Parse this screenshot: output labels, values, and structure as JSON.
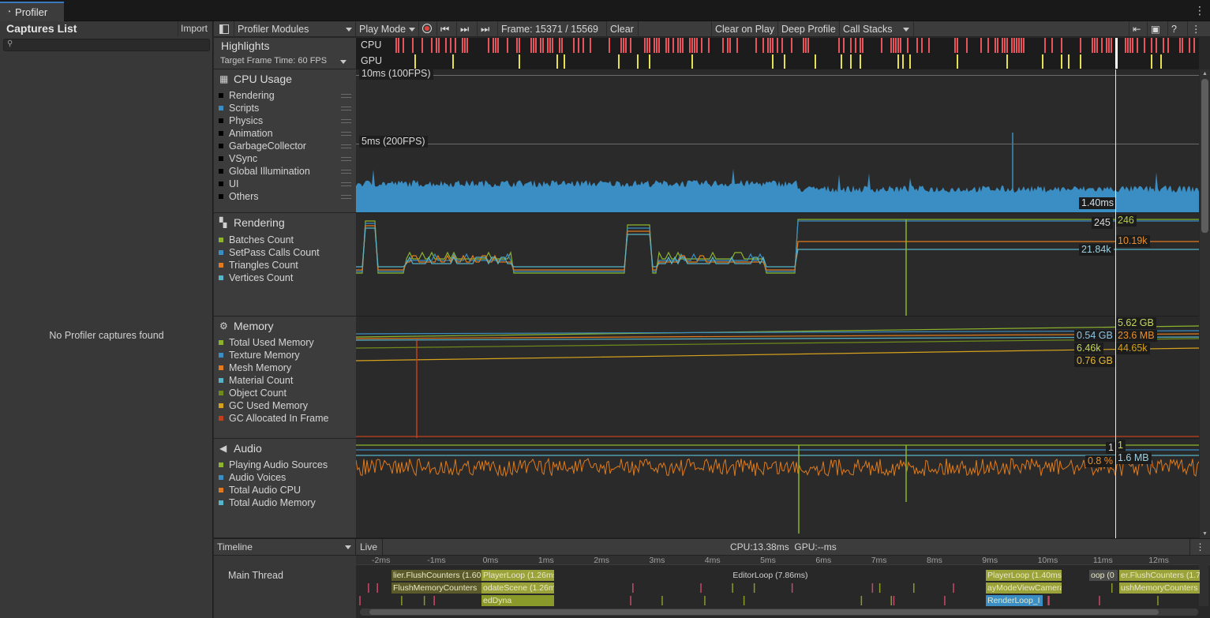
{
  "window": {
    "tab_title": "Profiler"
  },
  "captures": {
    "title": "Captures List",
    "import_label": "Import",
    "search_placeholder": "",
    "empty_message": "No Profiler captures found"
  },
  "toolbar": {
    "modules_label": "Profiler Modules",
    "play_mode_label": "Play Mode",
    "frame_label": "Frame: 15371 / 15569",
    "clear_label": "Clear",
    "clear_on_play_label": "Clear on Play",
    "deep_profile_label": "Deep Profile",
    "call_stacks_label": "Call Stacks"
  },
  "highlights": {
    "title": "Highlights",
    "target_frame_time": "Target Frame Time: 60 FPS",
    "cpu_label": "CPU",
    "gpu_label": "GPU",
    "cpu_color": "#e5555e",
    "gpu_color": "#e4e050"
  },
  "cpu_usage": {
    "title": "CPU Usage",
    "line_10ms": "10ms (100FPS)",
    "line_5ms": "5ms (200FPS)",
    "current_value": "1.40ms",
    "legend": [
      {
        "label": "Rendering",
        "color": "#000000"
      },
      {
        "label": "Scripts",
        "color": "#3a8ec3"
      },
      {
        "label": "Physics",
        "color": "#000000"
      },
      {
        "label": "Animation",
        "color": "#000000"
      },
      {
        "label": "GarbageCollector",
        "color": "#000000"
      },
      {
        "label": "VSync",
        "color": "#000000"
      },
      {
        "label": "Global Illumination",
        "color": "#000000"
      },
      {
        "label": "UI",
        "color": "#000000"
      },
      {
        "label": "Others",
        "color": "#000000"
      }
    ],
    "series_color": "#3a8ec3"
  },
  "rendering": {
    "title": "Rendering",
    "legend": [
      {
        "label": "Batches Count",
        "color": "#8bb42c"
      },
      {
        "label": "SetPass Calls Count",
        "color": "#3a8ec3"
      },
      {
        "label": "Triangles Count",
        "color": "#e07a1c"
      },
      {
        "label": "Vertices Count",
        "color": "#57b4c8"
      }
    ],
    "values": [
      {
        "text": "245",
        "color": "#d8d8d8"
      },
      {
        "text": "246",
        "color": "#b8d040"
      },
      {
        "text": "10.19k",
        "color": "#e8902c"
      },
      {
        "text": "21.84k",
        "color": "#9ed0e0"
      }
    ]
  },
  "memory": {
    "title": "Memory",
    "legend": [
      {
        "label": "Total Used Memory",
        "color": "#8bb42c"
      },
      {
        "label": "Texture Memory",
        "color": "#3a8ec3"
      },
      {
        "label": "Mesh Memory",
        "color": "#e07a1c"
      },
      {
        "label": "Material Count",
        "color": "#57b4c8"
      },
      {
        "label": "Object Count",
        "color": "#6e8c1a"
      },
      {
        "label": "GC Used Memory",
        "color": "#d6a21c"
      },
      {
        "label": "GC Allocated In Frame",
        "color": "#c0401c"
      }
    ],
    "values": [
      {
        "text": "5.62 GB",
        "color": "#c8d858"
      },
      {
        "text": "0.54 GB",
        "color": "#8cc4e4"
      },
      {
        "text": "23.6 MB",
        "color": "#e8902c"
      },
      {
        "text": "6.46k",
        "color": "#c8d858"
      },
      {
        "text": "44.65k",
        "color": "#d6a21c"
      },
      {
        "text": "0.76 GB",
        "color": "#e8b830"
      }
    ]
  },
  "audio": {
    "title": "Audio",
    "legend": [
      {
        "label": "Playing Audio Sources",
        "color": "#8bb42c"
      },
      {
        "label": "Audio Voices",
        "color": "#3a8ec3"
      },
      {
        "label": "Total Audio CPU",
        "color": "#e07a1c"
      },
      {
        "label": "Total Audio Memory",
        "color": "#57b4c8"
      }
    ],
    "values": [
      {
        "text": "1",
        "color": "#d8d8d8"
      },
      {
        "text": "1",
        "color": "#c8d858"
      },
      {
        "text": "0.8 %",
        "color": "#e8902c"
      },
      {
        "text": "1.6 MB",
        "color": "#9ed0e0"
      }
    ]
  },
  "timeline": {
    "view_label": "Timeline",
    "live_label": "Live",
    "stats": "CPU:13.38ms  GPU:--ms",
    "thread_label": "Main Thread",
    "ruler": [
      "-2ms",
      "-1ms",
      "0ms",
      "1ms",
      "2ms",
      "3ms",
      "4ms",
      "5ms",
      "6ms",
      "7ms",
      "8ms",
      "9ms",
      "10ms",
      "11ms",
      "12ms"
    ],
    "blocks": [
      {
        "text": "lier.FlushCounters (1.60",
        "color": "#5a5a2a"
      },
      {
        "text": "PlayerLoop (1.26ms",
        "color": "#9aa23a"
      },
      {
        "text": "EditorLoop (7.86ms)",
        "color": "#4a4a4a"
      },
      {
        "text": "PlayerLoop (1.40ms)",
        "color": "#9aa23a"
      },
      {
        "text": "oop (0",
        "color": "#4a4a4a"
      },
      {
        "text": "er.FlushCounters (1.7",
        "color": "#9aa23a"
      },
      {
        "text": "FlushMemoryCounters",
        "color": "#5a5a2a"
      },
      {
        "text": "odateScene (1.26m",
        "color": "#9aa23a"
      },
      {
        "text": "ayModeViewCameras",
        "color": "#9aa23a"
      },
      {
        "text": "ushMemoryCounters",
        "color": "#9aa23a"
      },
      {
        "text": "edDyna",
        "color": "#8a9a2a"
      },
      {
        "text": "RenderLoop_I",
        "color": "#3a8ec3"
      }
    ]
  }
}
